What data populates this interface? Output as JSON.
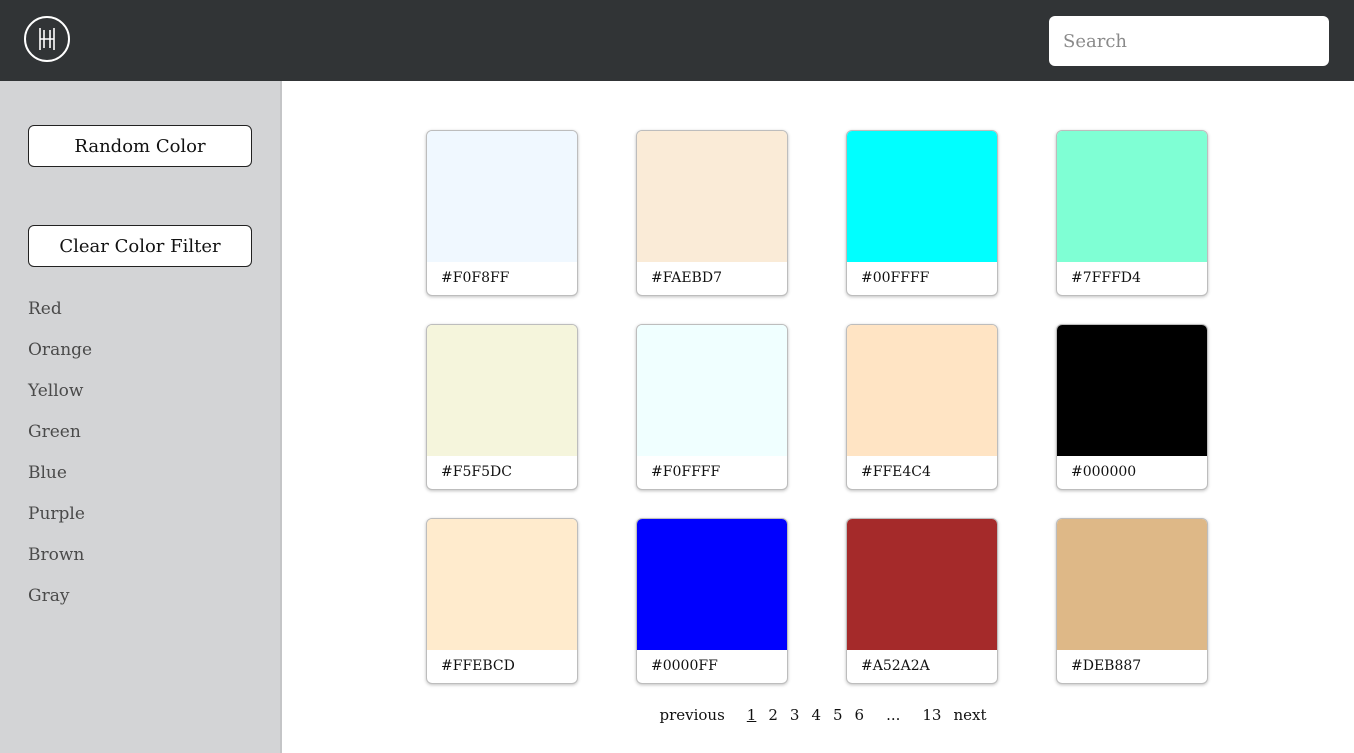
{
  "header": {
    "search_placeholder": "Search"
  },
  "sidebar": {
    "random_label": "Random Color",
    "clear_label": "Clear Color Filter",
    "filters": [
      "Red",
      "Orange",
      "Yellow",
      "Green",
      "Blue",
      "Purple",
      "Brown",
      "Gray"
    ]
  },
  "swatches": [
    {
      "hex": "#F0F8FF"
    },
    {
      "hex": "#FAEBD7"
    },
    {
      "hex": "#00FFFF"
    },
    {
      "hex": "#7FFFD4"
    },
    {
      "hex": "#F5F5DC"
    },
    {
      "hex": "#F0FFFF"
    },
    {
      "hex": "#FFE4C4"
    },
    {
      "hex": "#000000"
    },
    {
      "hex": "#FFEBCD"
    },
    {
      "hex": "#0000FF"
    },
    {
      "hex": "#A52A2A"
    },
    {
      "hex": "#DEB887"
    }
  ],
  "pagination": {
    "previous": "previous",
    "pages": [
      "1",
      "2",
      "3",
      "4",
      "5",
      "6",
      "...",
      "13"
    ],
    "current": "1",
    "next": "next"
  }
}
